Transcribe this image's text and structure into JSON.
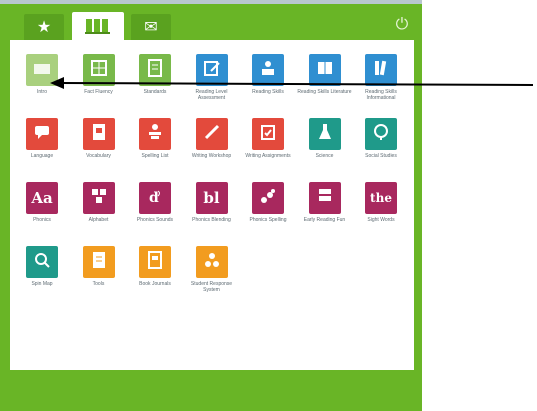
{
  "toolbar": {
    "tabs": [
      {
        "name": "favorites",
        "glyph": "★"
      },
      {
        "name": "apps",
        "glyph": ""
      },
      {
        "name": "messages",
        "glyph": "✉"
      }
    ],
    "power_glyph": "⏻"
  },
  "apps": [
    {
      "label": "Intro",
      "color": "#a9d07e",
      "glyph": "",
      "icon": "screen-icon"
    },
    {
      "label": "Fact Fluency",
      "color": "#79b94a",
      "glyph": "",
      "icon": "grid-icon"
    },
    {
      "label": "Standards",
      "color": "#79b94a",
      "glyph": "",
      "icon": "document-icon"
    },
    {
      "label": "Reading Level Assessment",
      "color": "#2f8fd1",
      "glyph": "",
      "icon": "clipboard-pen-icon"
    },
    {
      "label": "Reading Skills",
      "color": "#2f8fd1",
      "glyph": "",
      "icon": "reader-icon"
    },
    {
      "label": "Reading Skills Literature",
      "color": "#2f8fd1",
      "glyph": "",
      "icon": "book-icon"
    },
    {
      "label": "Reading Skills Informational",
      "color": "#2f8fd1",
      "glyph": "",
      "icon": "books-icon"
    },
    {
      "label": "Language",
      "color": "#e34a3c",
      "glyph": "",
      "icon": "speech-bubble-icon"
    },
    {
      "label": "Vocabulary",
      "color": "#e34a3c",
      "glyph": "",
      "icon": "dictionary-icon"
    },
    {
      "label": "Spelling List",
      "color": "#e34a3c",
      "glyph": "",
      "icon": "person-writing-icon"
    },
    {
      "label": "Writing Workshop",
      "color": "#e34a3c",
      "glyph": "",
      "icon": "pencil-icon"
    },
    {
      "label": "Writing Assignments",
      "color": "#e34a3c",
      "glyph": "",
      "icon": "clipboard-icon"
    },
    {
      "label": "Science",
      "color": "#1f9a8a",
      "glyph": "",
      "icon": "flask-icon"
    },
    {
      "label": "Social Studies",
      "color": "#1f9a8a",
      "glyph": "",
      "icon": "globe-icon"
    },
    {
      "label": "Phonics",
      "color": "#a8285e",
      "glyph": "Aa",
      "icon": "letters-icon"
    },
    {
      "label": "Alphabet",
      "color": "#a8285e",
      "glyph": "",
      "icon": "blocks-icon"
    },
    {
      "label": "Phonics Sounds",
      "color": "#a8285e",
      "glyph": "",
      "icon": "sound-letter-icon"
    },
    {
      "label": "Phonics Blending",
      "color": "#a8285e",
      "glyph": "bl",
      "icon": "blend-icon"
    },
    {
      "label": "Phonics Spelling",
      "color": "#a8285e",
      "glyph": "",
      "icon": "spelling-icon"
    },
    {
      "label": "Early Reading Fun",
      "color": "#a8285e",
      "glyph": "",
      "icon": "reading-fun-icon"
    },
    {
      "label": "Sight Words",
      "color": "#a8285e",
      "glyph": "the",
      "icon": "sight-words-icon"
    },
    {
      "label": "Spin Map",
      "color": "#1f9a8a",
      "glyph": "",
      "icon": "magnifier-globe-icon"
    },
    {
      "label": "Tools",
      "color": "#f29c1f",
      "glyph": "",
      "icon": "notepad-icon"
    },
    {
      "label": "Book Journals",
      "color": "#f29c1f",
      "glyph": "",
      "icon": "journal-icon"
    },
    {
      "label": "Student Response System",
      "color": "#f29c1f",
      "glyph": "",
      "icon": "response-dots-icon"
    }
  ]
}
